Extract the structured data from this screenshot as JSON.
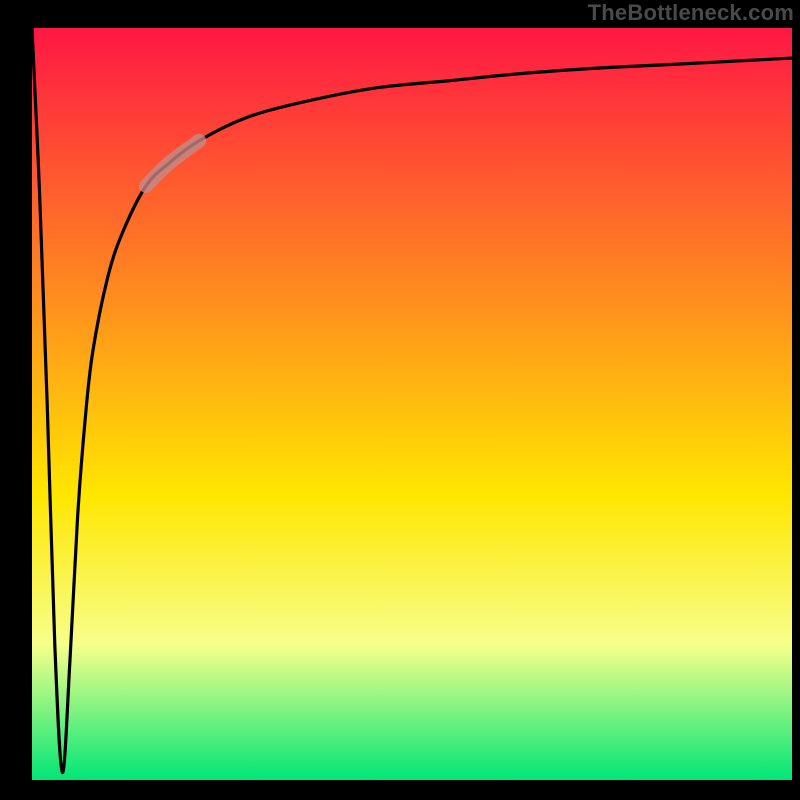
{
  "watermark": {
    "text": "TheBottleneck.com"
  },
  "colors": {
    "top": "#ff1744",
    "mid_upper": "#ff8a1f",
    "mid": "#ffe600",
    "mid_lower": "#f6ff8a",
    "bottom": "#00e676",
    "axis": "#000000",
    "curve": "#000000",
    "highlight": "#c48a8a"
  },
  "chart_data": {
    "type": "line",
    "title": "",
    "xlabel": "",
    "ylabel": "",
    "xlim": [
      0,
      100
    ],
    "ylim": [
      0,
      100
    ],
    "grid": false,
    "legend": false,
    "note": "Bottleneck-percentage style curve. y≈100 at x=0, falls to ≈0 near x≈4 (optimum), then rises sharply and asymptotes toward ≈96 as x grows.",
    "series": [
      {
        "name": "bottleneck-curve",
        "x": [
          0,
          1,
          2,
          3,
          4,
          5,
          6,
          7,
          8,
          10,
          12,
          15,
          18,
          22,
          28,
          35,
          45,
          55,
          65,
          75,
          85,
          100
        ],
        "y": [
          100,
          78,
          50,
          18,
          1,
          16,
          35,
          48,
          57,
          67,
          73,
          79,
          82,
          85,
          88,
          90,
          92,
          93,
          94,
          94.7,
          95.2,
          96
        ]
      }
    ],
    "highlight_segment": {
      "x_start": 15,
      "x_end": 22
    }
  }
}
